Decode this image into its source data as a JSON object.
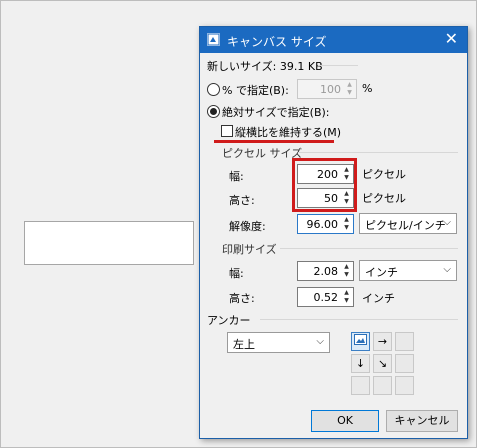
{
  "dialog": {
    "title": "キャンバス サイズ",
    "new_size_label": "新しいサイズ: 39.1 KB",
    "percent_radio_label": "% で指定(B):",
    "percent_value": "100",
    "percent_unit": "%",
    "absolute_radio_label": "絶対サイズで指定(B):",
    "keep_ratio_label": "縦横比を維持する(M)",
    "pixel_size_header": "ピクセル サイズ",
    "width_label": "幅:",
    "width_value": "200",
    "width_unit": "ピクセル",
    "height_label": "高さ:",
    "height_value": "50",
    "height_unit": "ピクセル",
    "resolution_label": "解像度:",
    "resolution_value": "96.00",
    "resolution_unit_select": "ピクセル/インチ",
    "print_size_header": "印刷サイズ",
    "print_width_label": "幅:",
    "print_width_value": "2.08",
    "print_unit_select": "インチ",
    "print_height_label": "高さ:",
    "print_height_value": "0.52",
    "print_height_unit": "インチ",
    "anchor_header": "アンカー",
    "anchor_select": "左上",
    "anchor_grid": [
      "picture-icon",
      "→",
      "",
      "↓",
      "↘",
      "",
      "",
      "",
      ""
    ],
    "ok_label": "OK",
    "cancel_label": "キャンセル"
  },
  "colors": {
    "titlebar": "#1b6ac1",
    "highlight_red": "#d01b1b",
    "focus_blue": "#2a78c8"
  }
}
